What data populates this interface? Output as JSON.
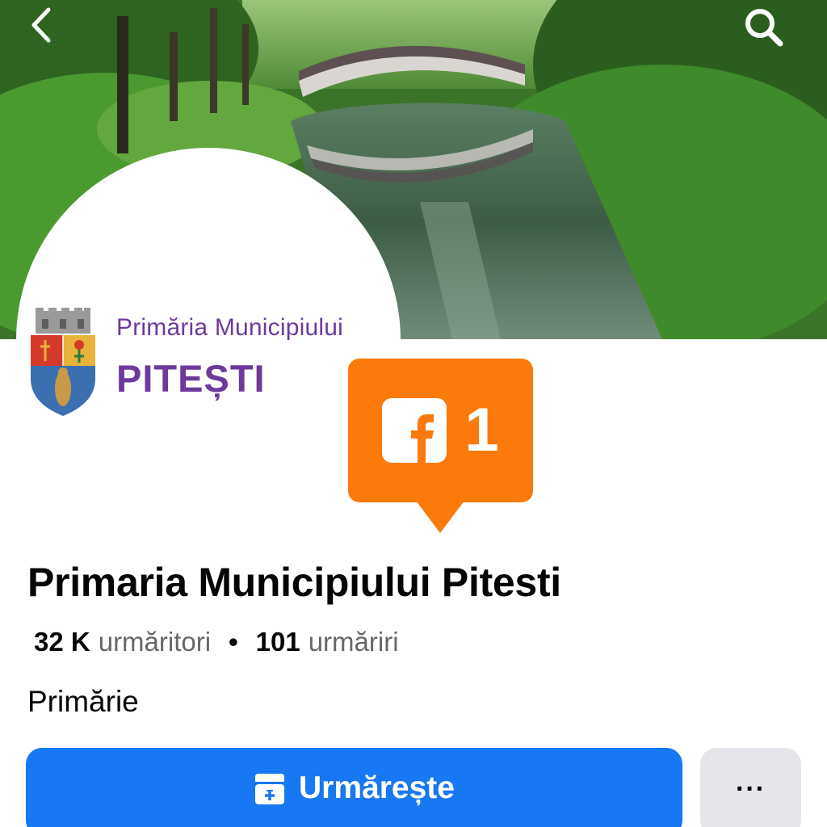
{
  "header": {
    "back_icon": "chevron-left-icon",
    "search_icon": "search-icon"
  },
  "profile_logo": {
    "line1": "Primăria Municipiului",
    "line2": "PITEȘTI"
  },
  "badge": {
    "icon": "facebook-icon",
    "count": "1",
    "color": "#fb7a0b"
  },
  "page": {
    "name": "Primaria Municipiului Pitesti",
    "followers_count": "32 K",
    "followers_label": "urmăritori",
    "separator": "•",
    "following_count": "101",
    "following_label": "urmăriri",
    "category": "Primărie"
  },
  "actions": {
    "follow_label": "Urmărește",
    "follow_icon": "follow-page-icon",
    "more_label": "···",
    "accent_color": "#1877f2"
  }
}
